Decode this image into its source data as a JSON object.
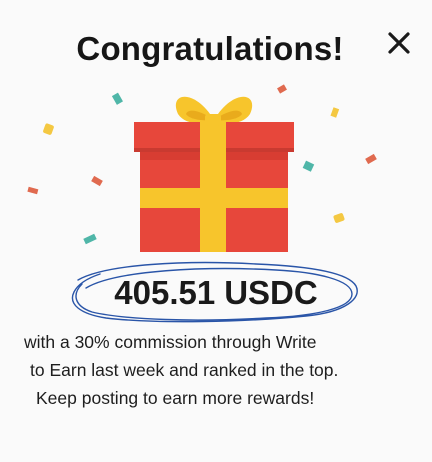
{
  "dialog": {
    "title": "Congratulations!",
    "close_icon": "close-icon",
    "amount": {
      "value": "405.51",
      "currency": "USDC"
    },
    "message_lines": [
      "with a 30% commission through Write",
      "to Earn last week and ranked in the top.",
      "Keep posting to earn more rewards!"
    ],
    "colors": {
      "gift_box": "#e7473b",
      "gift_ribbon": "#f7c52c",
      "confetti_teal": "#4fb6a8",
      "confetti_red": "#e06a4f",
      "confetti_yellow": "#f4c842",
      "scribble": "#2a55a8"
    }
  }
}
